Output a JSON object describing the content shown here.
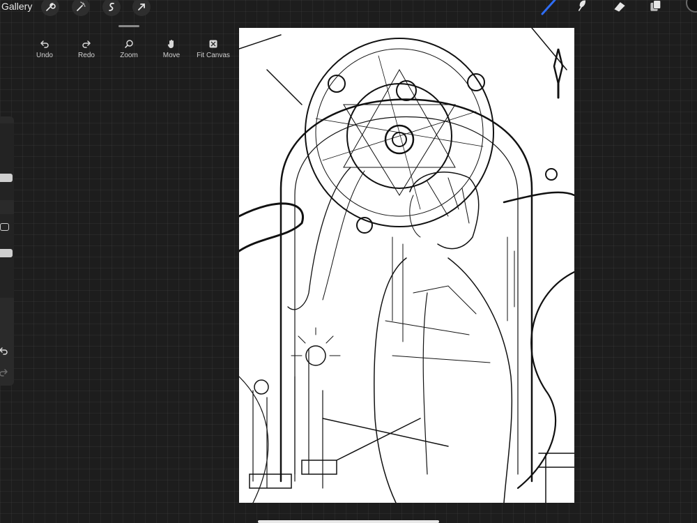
{
  "top_bar": {
    "gallery_label": "Gallery",
    "left_tools": [
      "wrench-icon",
      "magic-wand-icon",
      "selection-icon",
      "transform-arrow-icon"
    ],
    "right_tools": [
      "brush-icon",
      "smudge-icon",
      "eraser-icon",
      "layers-icon"
    ],
    "active_tool": "brush-icon",
    "accent_color": "#2f6df5",
    "current_color": "#111111"
  },
  "transform_menu": {
    "items": [
      {
        "label": "Undo",
        "icon": "undo-icon"
      },
      {
        "label": "Redo",
        "icon": "redo-icon"
      },
      {
        "label": "Zoom",
        "icon": "zoom-icon"
      },
      {
        "label": "Move",
        "icon": "hand-icon"
      },
      {
        "label": "Fit Canvas",
        "icon": "fit-canvas-icon"
      }
    ]
  },
  "sidebar": {
    "brush_size_level": 0.4,
    "opacity_level": 0.75,
    "icons": [
      "modify-square-icon",
      "undo-icon",
      "redo-icon"
    ]
  },
  "canvas": {
    "background": "#ffffff",
    "content": "line-art sketch"
  }
}
